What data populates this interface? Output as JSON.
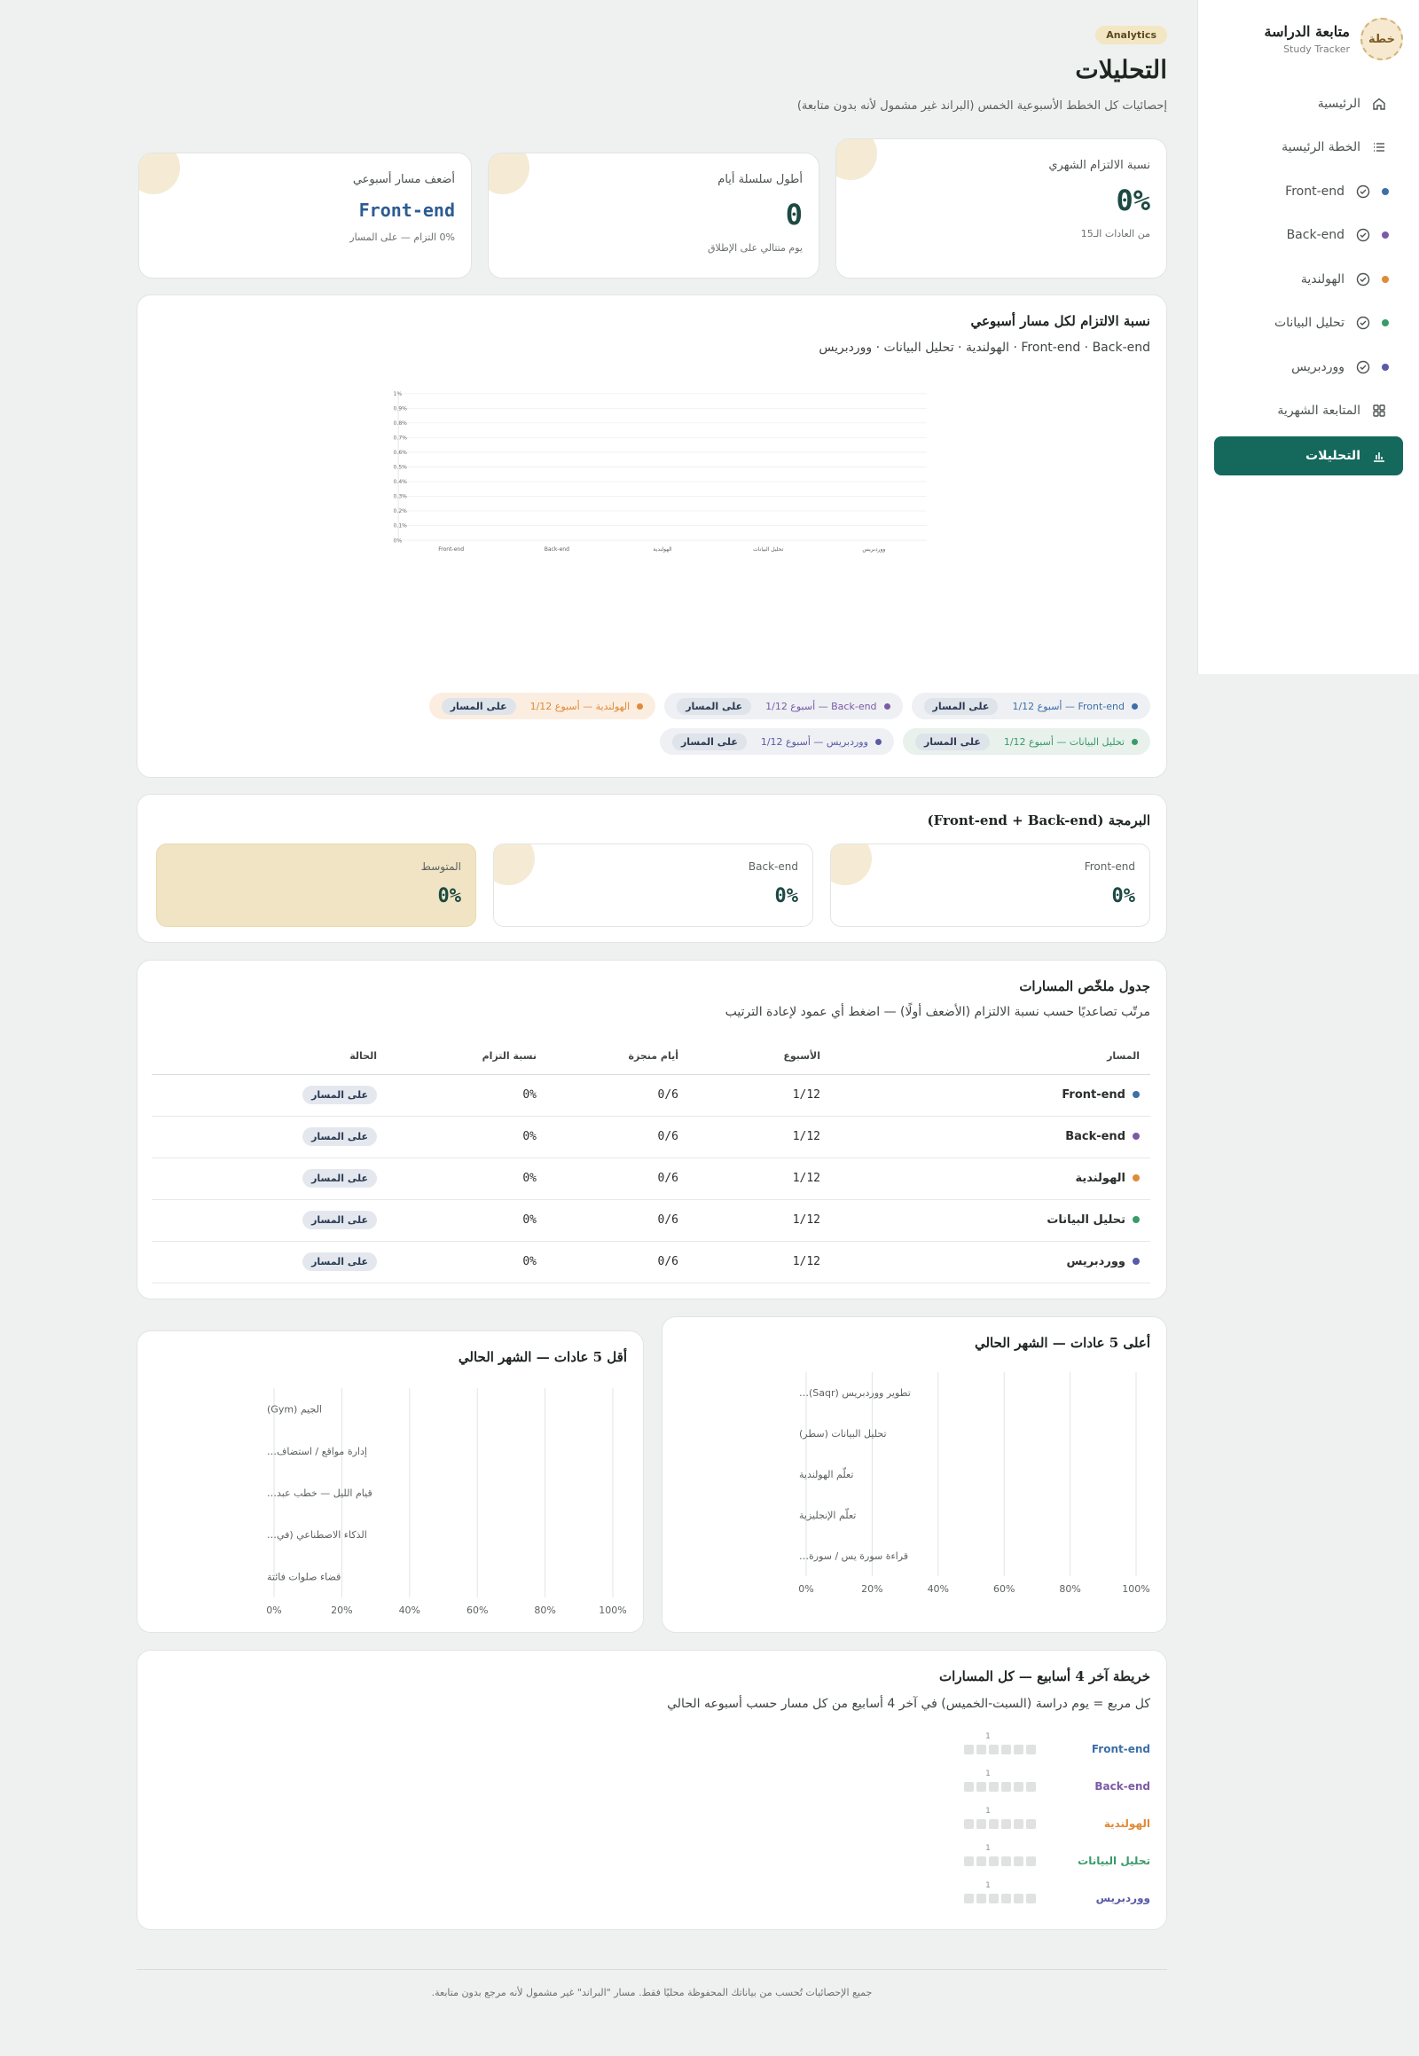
{
  "sidebar": {
    "logo_text": "خطة",
    "title": "متابعة الدراسة",
    "subtitle": "Study Tracker",
    "items": [
      {
        "label": "الرئيسية",
        "icon": "home-icon"
      },
      {
        "label": "الخطة الرئيسية",
        "icon": "list-icon"
      },
      {
        "label": "Front-end",
        "icon": "check-circle-icon",
        "color": "#3d6fa8"
      },
      {
        "label": "Back-end",
        "icon": "check-circle-icon",
        "color": "#7b5ba6"
      },
      {
        "label": "الهولندية",
        "icon": "check-circle-icon",
        "color": "#e08a3a"
      },
      {
        "label": "تحليل البيانات",
        "icon": "check-circle-icon",
        "color": "#3a9a6a"
      },
      {
        "label": "ووردبريس",
        "icon": "check-circle-icon",
        "color": "#5a5aa8"
      },
      {
        "label": "المتابعة الشهرية",
        "icon": "grid-icon"
      },
      {
        "label": "التحليلات",
        "icon": "bar-chart-icon",
        "active": true
      }
    ]
  },
  "header": {
    "badge": "Analytics",
    "title": "التحليلات",
    "subtitle": "إحصائيات كل الخطط الأسبوعية الخمس (البراند غير مشمول لأنه بدون متابعة)"
  },
  "kpis": [
    {
      "label": "نسبة الالتزام الشهري",
      "value": "0%",
      "note": "من العادات الـ15"
    },
    {
      "label": "أطول سلسلة أيام",
      "value": "0",
      "note": "يوم متتالي على الإطلاق"
    },
    {
      "label": "أضعف مسار أسبوعي",
      "value": "Front-end",
      "note": "0% التزام — على المسار"
    }
  ],
  "weekly_chart": {
    "title": "نسبة الالتزام لكل مسار أسبوعي",
    "subtitle": "Front-end · Back-end · الهولندية · تحليل البيانات · ووردبريس",
    "legend": [
      {
        "text": "Front-end — أسبوع 1/12",
        "state": "على المسار",
        "color": "#3d6fa8",
        "tone": "blue"
      },
      {
        "text": "Back-end — أسبوع 1/12",
        "state": "على المسار",
        "color": "#7b5ba6",
        "tone": "blue"
      },
      {
        "text": "الهولندية — أسبوع 1/12",
        "state": "على المسار",
        "color": "#e08a3a",
        "tone": "orange"
      },
      {
        "text": "تحليل البيانات — أسبوع 1/12",
        "state": "على المسار",
        "color": "#3a9a6a",
        "tone": "green"
      },
      {
        "text": "ووردبريس — أسبوع 1/12",
        "state": "على المسار",
        "color": "#5a5aa8",
        "tone": "blue"
      }
    ]
  },
  "programming": {
    "title": "البرمجة (Front-end + Back-end)",
    "cards": [
      {
        "label": "Front-end",
        "value": "0%"
      },
      {
        "label": "Back-end",
        "value": "0%"
      },
      {
        "label": "المتوسط",
        "value": "0%"
      }
    ]
  },
  "summary_table": {
    "title": "جدول ملخّص المسارات",
    "subtitle": "مرتّب تصاعديًا حسب نسبة الالتزام (الأضعف أولًا) — اضغط أي عمود لإعادة الترتيب",
    "columns": [
      "المسار",
      "الأسبوع",
      "أيام منجزة",
      "نسبة التزام",
      "الحالة"
    ],
    "rows": [
      {
        "track": "Front-end",
        "color": "#3d6fa8",
        "week": "1/12",
        "days": "0/6",
        "pct": "0%",
        "status": "على المسار"
      },
      {
        "track": "Back-end",
        "color": "#7b5ba6",
        "week": "1/12",
        "days": "0/6",
        "pct": "0%",
        "status": "على المسار"
      },
      {
        "track": "الهولندية",
        "color": "#e08a3a",
        "week": "1/12",
        "days": "0/6",
        "pct": "0%",
        "status": "على المسار"
      },
      {
        "track": "تحليل البيانات",
        "color": "#3a9a6a",
        "week": "1/12",
        "days": "0/6",
        "pct": "0%",
        "status": "على المسار"
      },
      {
        "track": "ووردبريس",
        "color": "#5a5aa8",
        "week": "1/12",
        "days": "0/6",
        "pct": "0%",
        "status": "على المسار"
      }
    ]
  },
  "top_habits": {
    "title": "أعلى 5 عادات — الشهر الحالي"
  },
  "low_habits": {
    "title": "أقل 5 عادات — الشهر الحالي"
  },
  "heatmap": {
    "title": "خريطة آخر 4 أسابيع — كل المسارات",
    "subtitle": "كل مربع = يوم دراسة (السبت-الخميس) في آخر 4 أسابيع من كل مسار حسب أسبوعه الحالي",
    "rows": [
      {
        "label": "Front-end",
        "color": "#3d6fa8",
        "week": "1"
      },
      {
        "label": "Back-end",
        "color": "#7b5ba6",
        "week": "1"
      },
      {
        "label": "الهولندية",
        "color": "#e08a3a",
        "week": "1"
      },
      {
        "label": "تحليل البيانات",
        "color": "#3a9a6a",
        "week": "1"
      },
      {
        "label": "ووردبريس",
        "color": "#5a5aa8",
        "week": "1"
      }
    ]
  },
  "footer": "جميع الإحصائيات تُحسب من بياناتك المحفوظة محليًا فقط. مسار \"البراند\" غير مشمول لأنه مرجع بدون متابعة.",
  "chart_data": [
    {
      "type": "bar",
      "title": "نسبة الالتزام لكل مسار أسبوعي",
      "categories": [
        "Front-end",
        "Back-end",
        "الهولندية",
        "تحليل البيانات",
        "ووردبريس"
      ],
      "values": [
        0,
        0,
        0,
        0,
        0
      ],
      "ylim": [
        0,
        1
      ],
      "yticks": [
        "0%",
        "0.1%",
        "0.2%",
        "0.3%",
        "0.4%",
        "0.5%",
        "0.6%",
        "0.7%",
        "0.8%",
        "0.9%",
        "1%"
      ],
      "grid": true
    },
    {
      "type": "bar",
      "orientation": "horizontal",
      "title": "أعلى 5 عادات — الشهر الحالي",
      "categories": [
        "تطوير ووردبريس (Saqr)…",
        "تحليل البيانات (سطر)",
        "تعلّم الهولندية",
        "تعلّم الإنجليزية",
        "قراءة سورة يس / سورة…"
      ],
      "values": [
        0,
        0,
        0,
        0,
        0
      ],
      "xlim": [
        0,
        100
      ],
      "xticks": [
        "0%",
        "20%",
        "40%",
        "60%",
        "80%",
        "100%"
      ]
    },
    {
      "type": "bar",
      "orientation": "horizontal",
      "title": "أقل 5 عادات — الشهر الحالي",
      "categories": [
        "الجيم (Gym)",
        "إدارة مواقع / استضاف…",
        "قيام الليل — خطب عبد…",
        "الذكاء الاصطناعي (في…",
        "قضاء صلوات فائتة"
      ],
      "values": [
        0,
        0,
        0,
        0,
        0
      ],
      "xlim": [
        0,
        100
      ],
      "xticks": [
        "0%",
        "20%",
        "40%",
        "60%",
        "80%",
        "100%"
      ]
    }
  ]
}
